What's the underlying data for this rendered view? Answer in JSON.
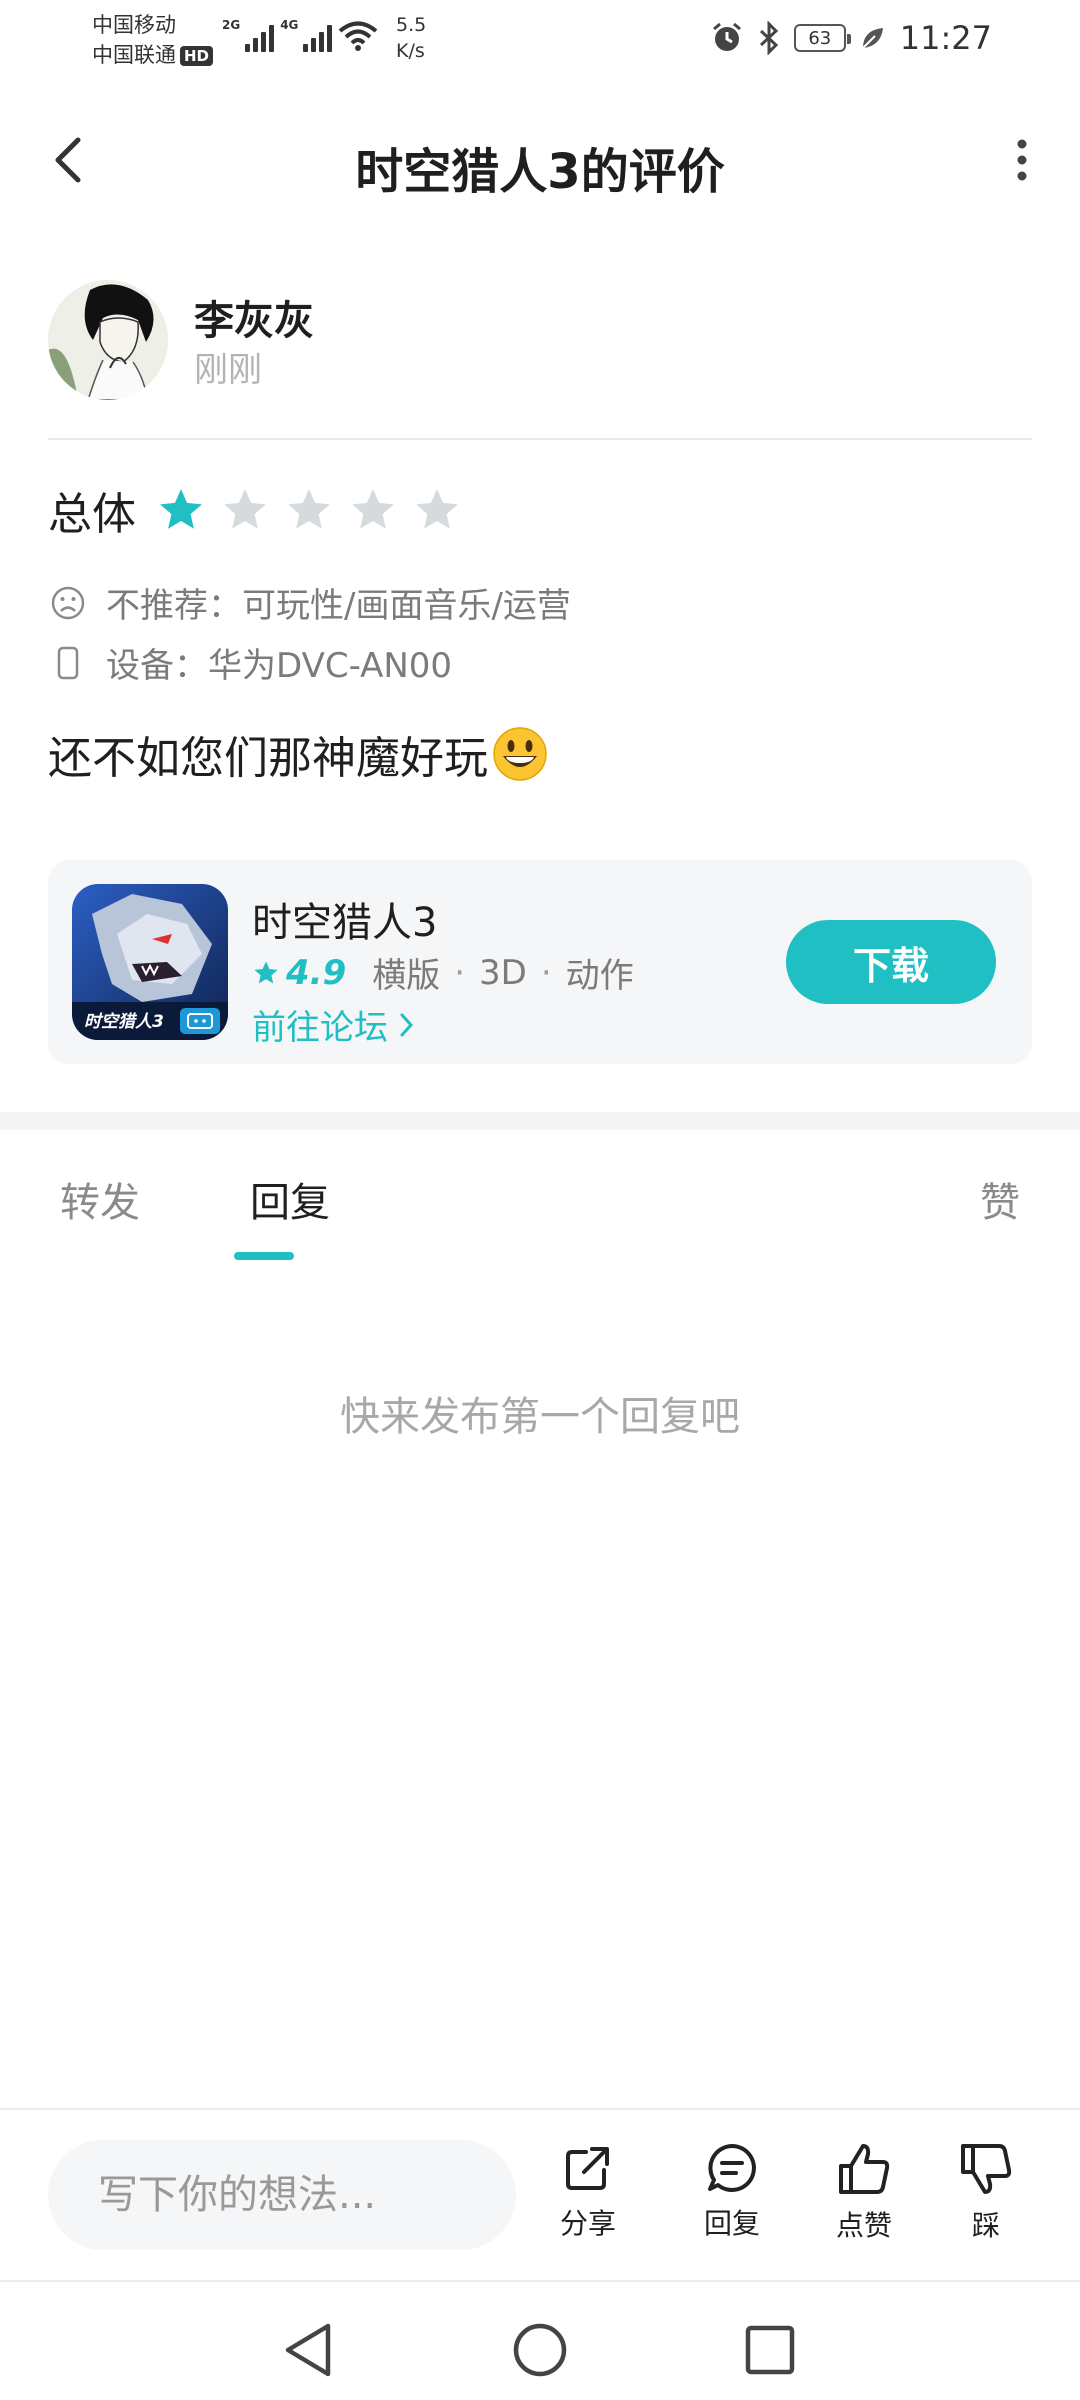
{
  "status_bar": {
    "carrier1": "中国移动",
    "carrier2": "中国联通",
    "hd": "HD",
    "net1": "2G",
    "net2": "4G",
    "speed_value": "5.5",
    "speed_unit": "K/s",
    "battery": "63",
    "time": "11:27"
  },
  "header": {
    "title": "时空猎人3的评价",
    "back_icon": "back-arrow-icon",
    "more_icon": "more-vertical-icon"
  },
  "user": {
    "name": "李灰灰",
    "time": "刚刚"
  },
  "rating": {
    "label": "总体",
    "stars_filled": 1,
    "stars_total": 5,
    "colors": {
      "filled": "#1fbfc3",
      "empty": "#d5dade"
    }
  },
  "meta": {
    "not_recommend": "不推荐：可玩性/画面音乐/运营",
    "device": "设备：华为DVC-AN00"
  },
  "review": {
    "text": "还不如您们那神魔好玩"
  },
  "game_card": {
    "name": "时空猎人3",
    "score": "4.9",
    "tags": [
      "横版",
      "3D",
      "动作"
    ],
    "forum_link": "前往论坛",
    "download": "下载",
    "icon_text": "时空猎人3"
  },
  "tabs": {
    "forward": "转发",
    "reply": "回复",
    "like": "赞",
    "active": "reply"
  },
  "empty_state": "快来发布第一个回复吧",
  "bottom_bar": {
    "placeholder": "写下你的想法...",
    "share": "分享",
    "reply": "回复",
    "like": "点赞",
    "dislike": "踩"
  },
  "accent_color": "#1fbfc3"
}
